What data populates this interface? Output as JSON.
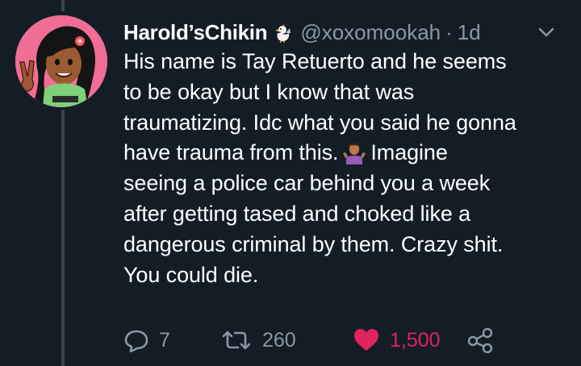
{
  "tweet": {
    "display_name": "Harold’sChikin",
    "name_emoji": "rooster-emoji",
    "handle": "@xoxomookah",
    "separator": "·",
    "time": "1d",
    "menu_icon": "chevron-down-icon",
    "avatar": "cartoon-avatar-girl-peace-sign",
    "lines": [
      "His name is Tay Retuerto and he seems",
      "to be okay but I know that was",
      "traumatizing. Idc what you said he gonna",
      "have trauma from this.",
      "Imagine",
      "seeing a police car behind you a week",
      "after getting tased and choked like a",
      "dangerous criminal by them. Crazy shit.",
      "You could die."
    ],
    "inline_emoji": "person-shrugging-emoji"
  },
  "actions": {
    "reply": {
      "icon": "reply-icon",
      "count": "7"
    },
    "retweet": {
      "icon": "retweet-icon",
      "count": "260"
    },
    "like": {
      "icon": "heart-icon",
      "count": "1,500",
      "color": "#e0245e"
    },
    "share": {
      "icon": "share-icon"
    }
  },
  "colors": {
    "background": "#141d26",
    "secondary_text": "#8899a6",
    "like_active": "#e0245e",
    "thread_line": "#38444d",
    "avatar_bg": "#f06d95"
  }
}
